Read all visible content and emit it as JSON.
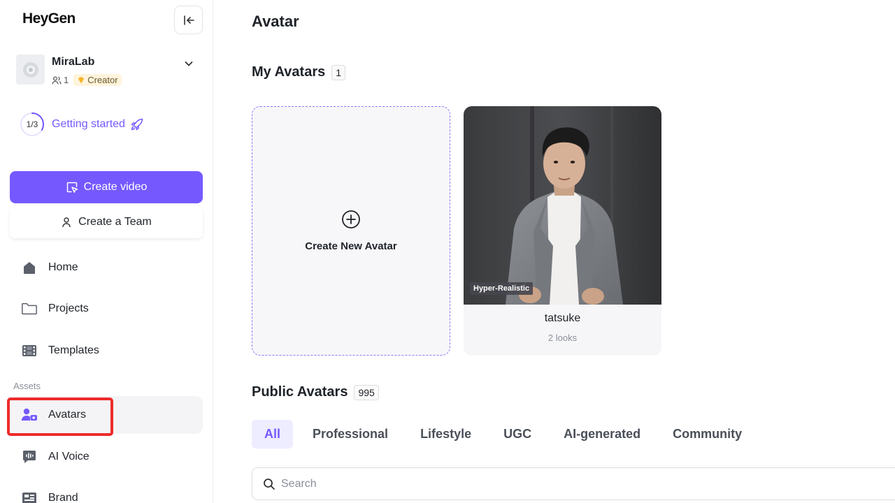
{
  "sidebar": {
    "logo": "HeyGen",
    "workspace": {
      "name": "MiraLab",
      "members": "1",
      "plan": "Creator"
    },
    "getting_started": {
      "progress": "1/3",
      "label": "Getting started"
    },
    "create_video": "Create video",
    "create_team": "Create a Team",
    "nav": [
      {
        "label": "Home",
        "icon": "home-icon"
      },
      {
        "label": "Projects",
        "icon": "folder-icon"
      },
      {
        "label": "Templates",
        "icon": "film-icon"
      }
    ],
    "assets_label": "Assets",
    "assets_nav": [
      {
        "label": "Avatars",
        "icon": "avatar-icon",
        "active": true
      },
      {
        "label": "AI Voice",
        "icon": "voice-icon"
      },
      {
        "label": "Brand",
        "icon": "brand-icon"
      }
    ]
  },
  "main": {
    "title": "Avatar",
    "my_avatars": {
      "title": "My Avatars",
      "count": "1",
      "create_label": "Create New Avatar",
      "items": [
        {
          "name": "tatsuke",
          "looks": "2 looks",
          "tag": "Hyper-Realistic"
        }
      ]
    },
    "public_avatars": {
      "title": "Public Avatars",
      "count": "995",
      "tabs": [
        "All",
        "Professional",
        "Lifestyle",
        "UGC",
        "AI-generated",
        "Community"
      ],
      "active_tab": "All"
    },
    "search": {
      "placeholder": "Search"
    }
  },
  "colors": {
    "accent": "#7559ff",
    "highlight": "#ee2b2b"
  }
}
